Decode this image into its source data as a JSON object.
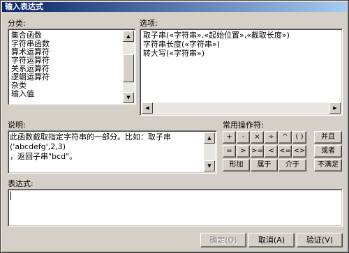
{
  "dialog": {
    "title": "输入表达式"
  },
  "category": {
    "label": "分类:",
    "items": [
      "集合函数",
      "字符串函数",
      "算术运算符",
      "字符运算符",
      "关系运算符",
      "逻辑运算符",
      "杂类",
      "输入值"
    ]
  },
  "options": {
    "label": "选项:",
    "items": [
      "取子串(«字符串»,«起始位置»,«截取长度»)",
      "字符串长度(«字符串»)",
      "转大写(«字符串»)"
    ]
  },
  "description": {
    "label": "说明:",
    "line1": "此函数截取指定字符串的一部分。比如：取子串('abcdefg',2,3)",
    "line2": "，返回子串\"bcd\"。"
  },
  "operators": {
    "label": "常用操作符:",
    "row1": [
      "+",
      "-",
      "×",
      "÷",
      "^",
      "( )"
    ],
    "row2": [
      "=",
      ">",
      ">=",
      "<",
      "<=",
      "<>"
    ],
    "row3": [
      "形加",
      "属于",
      "介于"
    ],
    "logic": [
      "并且",
      "或者",
      "不满足"
    ]
  },
  "expression": {
    "label": "表达式:",
    "value": ""
  },
  "buttons": {
    "ok": "确定(O)",
    "cancel": "取消(A)",
    "verify": "验证(V)"
  },
  "scroll_icons": {
    "up": "▲",
    "down": "▼",
    "left": "◀",
    "right": "▶"
  }
}
